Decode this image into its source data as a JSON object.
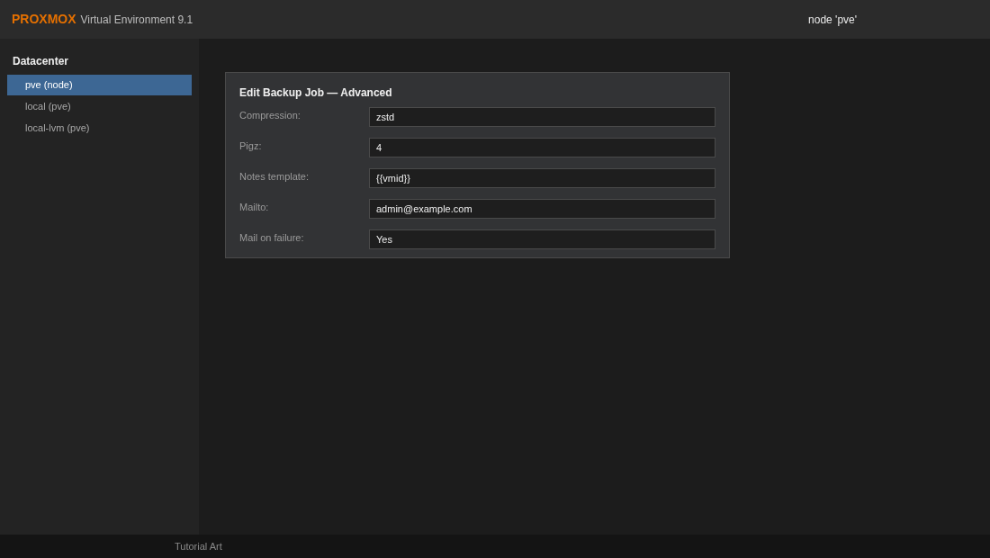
{
  "header": {
    "logo": "PROXMOX",
    "product": "Virtual Environment 9.1",
    "context": "node 'pve'"
  },
  "sidebar": {
    "title": "Datacenter",
    "items": [
      {
        "label": "pve (node)",
        "selected": true
      },
      {
        "label": "local (pve)",
        "selected": false
      },
      {
        "label": "local-lvm (pve)",
        "selected": false
      }
    ]
  },
  "dialog": {
    "title": "Edit Backup Job — Advanced",
    "fields": [
      {
        "label": "Compression:",
        "value": "zstd"
      },
      {
        "label": "Pigz:",
        "value": "4"
      },
      {
        "label": "Notes template:",
        "value": "{{vmid}}"
      },
      {
        "label": "Mailto:",
        "value": "admin@example.com"
      },
      {
        "label": "Mail on failure:",
        "value": "Yes"
      }
    ]
  },
  "status_bar": {
    "text": "Tutorial Art"
  }
}
